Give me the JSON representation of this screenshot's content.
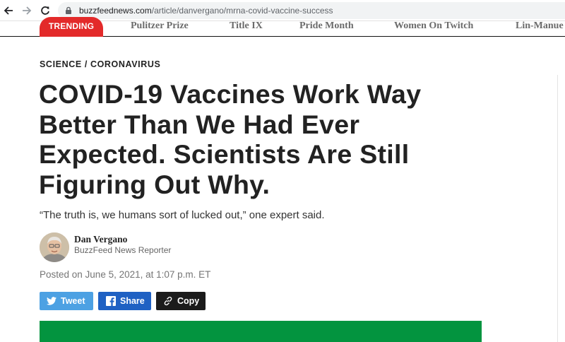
{
  "browser": {
    "url_domain": "buzzfeednews.com",
    "url_path": "/article/danvergano/mrna-covid-vaccine-success"
  },
  "site_nav": {
    "trending_label": "TRENDING",
    "links": [
      "Pulitzer Prize",
      "Title IX",
      "Pride Month",
      "Women On Twitch",
      "Lin-Manue"
    ]
  },
  "article": {
    "section": "SCIENCE / CORONAVIRUS",
    "headline_lines": [
      "COVID-19 Vaccines Work Way",
      "Better Than We Had Ever",
      "Expected. Scientists Are Still",
      "Figuring Out Why."
    ],
    "dek": "“The truth is, we humans sort of lucked out,” one expert said.",
    "author": {
      "name": "Dan Vergano",
      "role": "BuzzFeed News Reporter"
    },
    "posted": "Posted on June 5, 2021, at 1:07 p.m. ET",
    "share": {
      "tweet_label": "Tweet",
      "facebook_label": "Share",
      "copy_label": "Copy"
    }
  },
  "colors": {
    "trending": "#e32a2a",
    "twitter": "#4da1e3",
    "facebook": "#1f61c3",
    "copy": "#1b1b1b",
    "hero": "#03943f"
  },
  "icons": [
    "back-arrow-icon",
    "forward-arrow-icon",
    "reload-icon",
    "lock-icon",
    "twitter-bird-icon",
    "facebook-icon",
    "link-icon"
  ]
}
